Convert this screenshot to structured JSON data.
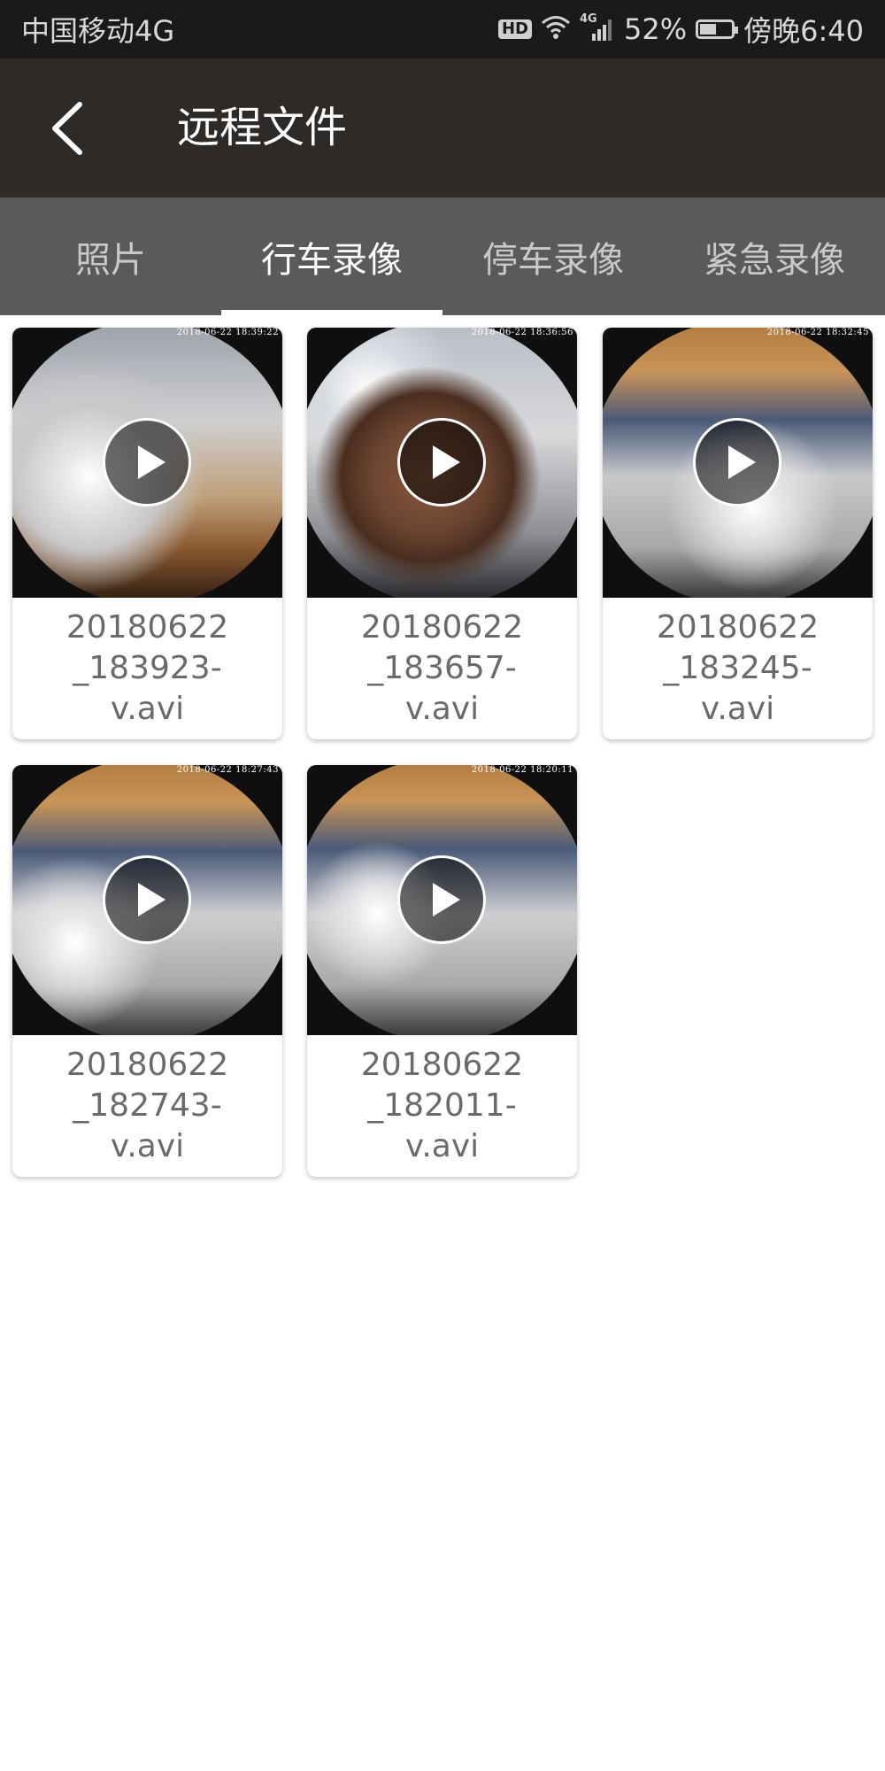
{
  "status_bar": {
    "carrier": "中国移动4G",
    "hd_badge": "HD",
    "network": "4G",
    "battery": "52%",
    "battery_level": 0.52,
    "time": "傍晚6:40"
  },
  "app_bar": {
    "title": "远程文件",
    "back_icon": "chevron-left-icon"
  },
  "tabs": [
    {
      "label": "照片",
      "active": false
    },
    {
      "label": "行车录像",
      "active": true
    },
    {
      "label": "停车录像",
      "active": false
    },
    {
      "label": "紧急录像",
      "active": false
    }
  ],
  "files": [
    {
      "timestamp": "2018-06-22 18:39:22",
      "name_lines": [
        "20180622",
        "_183923-",
        "v.avi"
      ]
    },
    {
      "timestamp": "2018-06-22 18:36:56",
      "name_lines": [
        "20180622",
        "_183657-",
        "v.avi"
      ]
    },
    {
      "timestamp": "2018-06-22 18:32:45",
      "name_lines": [
        "20180622",
        "_183245-",
        "v.avi"
      ]
    },
    {
      "timestamp": "2018-06-22 18:27:43",
      "name_lines": [
        "20180622",
        "_182743-",
        "v.avi"
      ]
    },
    {
      "timestamp": "2018-06-22 18:20:11",
      "name_lines": [
        "20180622",
        "_182011-",
        "v.avi"
      ]
    }
  ],
  "colors": {
    "status_bar": "#1b1a18",
    "app_bar": "#2d2a28",
    "tab_bar": "#5b5a59",
    "tab_active_text": "#ffffff",
    "tab_inactive_text": "#c9c9c9",
    "filename_text": "#6a6a6a"
  }
}
